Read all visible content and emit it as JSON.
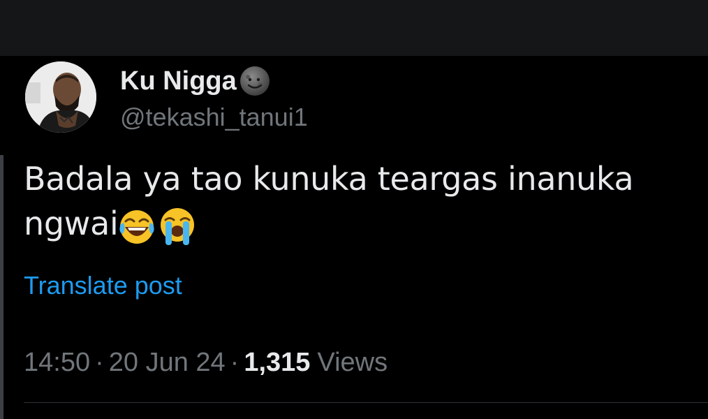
{
  "tweet": {
    "display_name": "Ku Nigga",
    "name_emoji_icon": "new-moon-face-emoji",
    "handle": "@tekashi_tanui1",
    "text_line1": "Badala ya tao kunuka teargas inanuka",
    "text_line2": "ngwai",
    "text_emojis": [
      "face-with-tears-of-joy-emoji",
      "loudly-crying-face-emoji"
    ],
    "translate_label": "Translate post",
    "time": "14:50",
    "date": "20 Jun 24",
    "separator": "·",
    "views_count": "1,315",
    "views_label": "Views"
  },
  "colors": {
    "background": "#000000",
    "top_bar": "#151617",
    "primary_text": "#e7e9ea",
    "secondary_text": "#71767b",
    "link": "#1d9bf0"
  }
}
